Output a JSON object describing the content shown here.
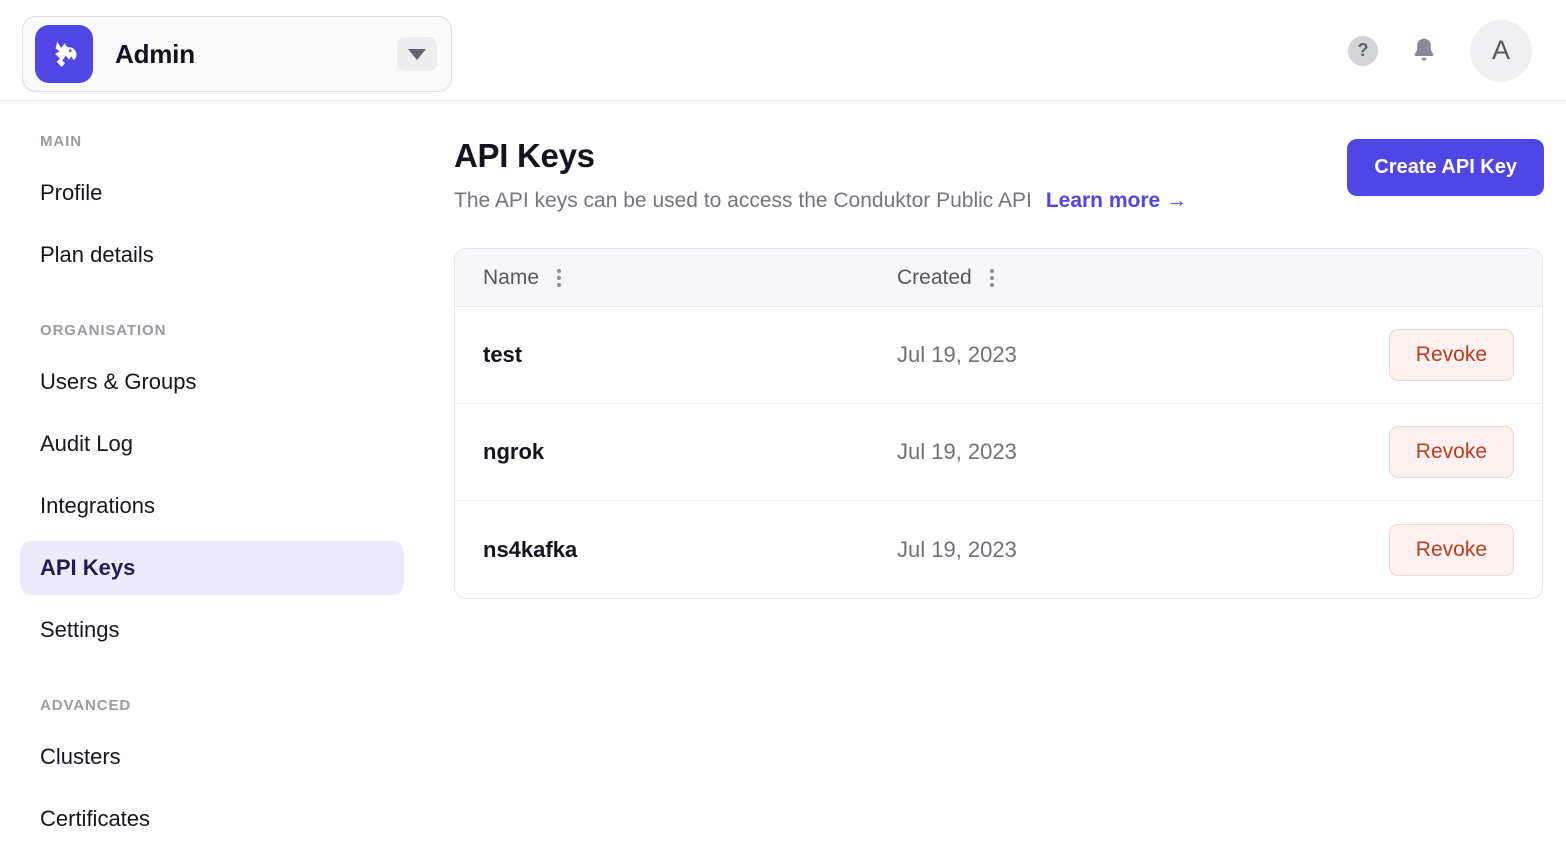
{
  "header": {
    "org_name": "Admin",
    "logo_icon": "conduktor-wolf-logo",
    "chevron_icon": "chevron-down-icon",
    "help_icon": "question-mark-icon",
    "help_glyph": "?",
    "bell_icon": "bell-icon",
    "avatar_initial": "A"
  },
  "sidebar": {
    "sections": [
      {
        "label": "MAIN",
        "items": [
          {
            "label": "Profile",
            "active": false
          },
          {
            "label": "Plan details",
            "active": false
          }
        ]
      },
      {
        "label": "ORGANISATION",
        "items": [
          {
            "label": "Users & Groups",
            "active": false
          },
          {
            "label": "Audit Log",
            "active": false
          },
          {
            "label": "Integrations",
            "active": false
          },
          {
            "label": "API Keys",
            "active": true
          },
          {
            "label": "Settings",
            "active": false
          }
        ]
      },
      {
        "label": "ADVANCED",
        "items": [
          {
            "label": "Clusters",
            "active": false
          },
          {
            "label": "Certificates",
            "active": false
          }
        ]
      }
    ]
  },
  "main": {
    "title": "API Keys",
    "subtitle": "The API keys can be used to access the Conduktor Public API",
    "learn_more_label": "Learn more →",
    "create_button_label": "Create API Key",
    "table": {
      "columns": [
        {
          "label": "Name",
          "menu_icon": "kebab-menu-icon"
        },
        {
          "label": "Created",
          "menu_icon": "kebab-menu-icon"
        }
      ],
      "rows": [
        {
          "name": "test",
          "created": "Jul 19, 2023",
          "action_label": "Revoke"
        },
        {
          "name": "ngrok",
          "created": "Jul 19, 2023",
          "action_label": "Revoke"
        },
        {
          "name": "ns4kafka",
          "created": "Jul 19, 2023",
          "action_label": "Revoke"
        }
      ]
    }
  },
  "colors": {
    "brand_indigo": "#4F46E5",
    "active_nav_bg": "#EDEBFA",
    "active_nav_text": "#231B54",
    "danger_text": "#BF3B21",
    "danger_bg": "#FDF2F0",
    "danger_border": "#F4D4CE",
    "muted_text": "#74747E",
    "table_header_bg": "#F7F7F9"
  }
}
